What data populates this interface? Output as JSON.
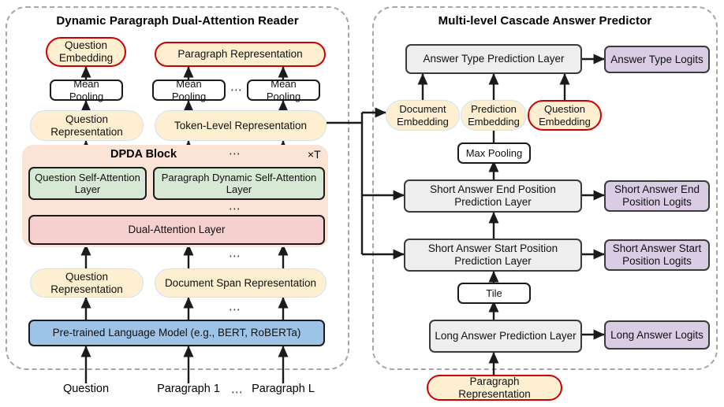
{
  "panels": {
    "left": {
      "title": "Dynamic Paragraph Dual-Attention Reader"
    },
    "right": {
      "title": "Multi-level Cascade Answer Predictor"
    }
  },
  "left_panel": {
    "question_embedding": "Question Embedding",
    "paragraph_representation": "Paragraph Representation",
    "mean_pooling_q": "Mean Pooling",
    "mean_pooling_p1": "Mean Pooling",
    "mean_pooling_pl": "Mean Pooling",
    "question_representation_top": "Question Representation",
    "token_level_representation": "Token-Level Representation",
    "dpda_block_title": "DPDA Block",
    "repeat_marker": "×T",
    "question_self_attention": "Question Self-Attention Layer",
    "paragraph_dynamic_self_attention": "Paragraph  Dynamic  Self-Attention Layer",
    "dual_attention": "Dual-Attention Layer",
    "question_representation_bottom": "Question Representation",
    "document_span_representation": "Document Span Representation",
    "plm": "Pre-trained Language Model (e.g., BERT, RoBERTa)",
    "input_question": "Question",
    "input_paragraph_1": "Paragraph 1",
    "input_paragraph_l": "Paragraph L",
    "ellipsis": "⋯"
  },
  "right_panel": {
    "answer_type_prediction_layer": "Answer Type Prediction Layer",
    "answer_type_logits": "Answer Type Logits",
    "document_embedding": "Document Embedding",
    "prediction_embedding": "Prediction Embedding",
    "question_embedding": "Question Embedding",
    "max_pooling": "Max Pooling",
    "short_answer_end_layer": "Short Answer End Position Prediction Layer",
    "short_answer_end_logits": "Short Answer End Position Logits",
    "short_answer_start_layer": "Short Answer Start Position Prediction Layer",
    "short_answer_start_logits": "Short Answer Start Position Logits",
    "tile": "Tile",
    "long_answer_prediction_layer": "Long Answer Prediction Layer",
    "long_answer_logits": "Long Answer Logits",
    "paragraph_representation": "Paragraph Representation"
  },
  "colors": {
    "panel_border": "#a6a6a6",
    "highlight_red": "#cc0000",
    "yellow_fill": "#fdefd0",
    "green_fill": "#d7e8d4",
    "pink_fill": "#f6cfcf",
    "blue_fill": "#9dc3e6",
    "grey_fill": "#eeeeee",
    "purple_fill": "#d9cce4",
    "peach_fill": "#fbe4d5",
    "wire": "#1b1b1b"
  }
}
